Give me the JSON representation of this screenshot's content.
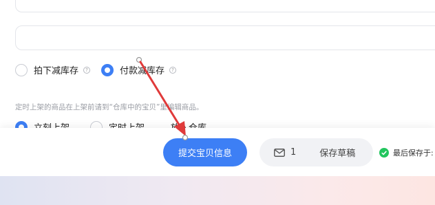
{
  "inventory": {
    "option_1": "拍下减库存",
    "option_2": "付款减库存",
    "help_glyph": "?"
  },
  "listing": {
    "hint": "定时上架的商品在上架前请到“仓库中的宝贝”里编辑商品。",
    "option_1": "立刻上架",
    "option_2": "定时上架",
    "option_3": "放入仓库"
  },
  "footer": {
    "submit_label": "提交宝贝信息",
    "message_count": "1",
    "save_draft_label": "保存草稿",
    "last_saved_label": "最后保存于:"
  },
  "colors": {
    "accent": "#3d7ff5",
    "annotation_arrow": "#e03a3a",
    "success": "#22c55e"
  },
  "icons": {
    "mail": "mail-icon",
    "success": "check-circle-icon",
    "help": "question-circle-icon"
  }
}
